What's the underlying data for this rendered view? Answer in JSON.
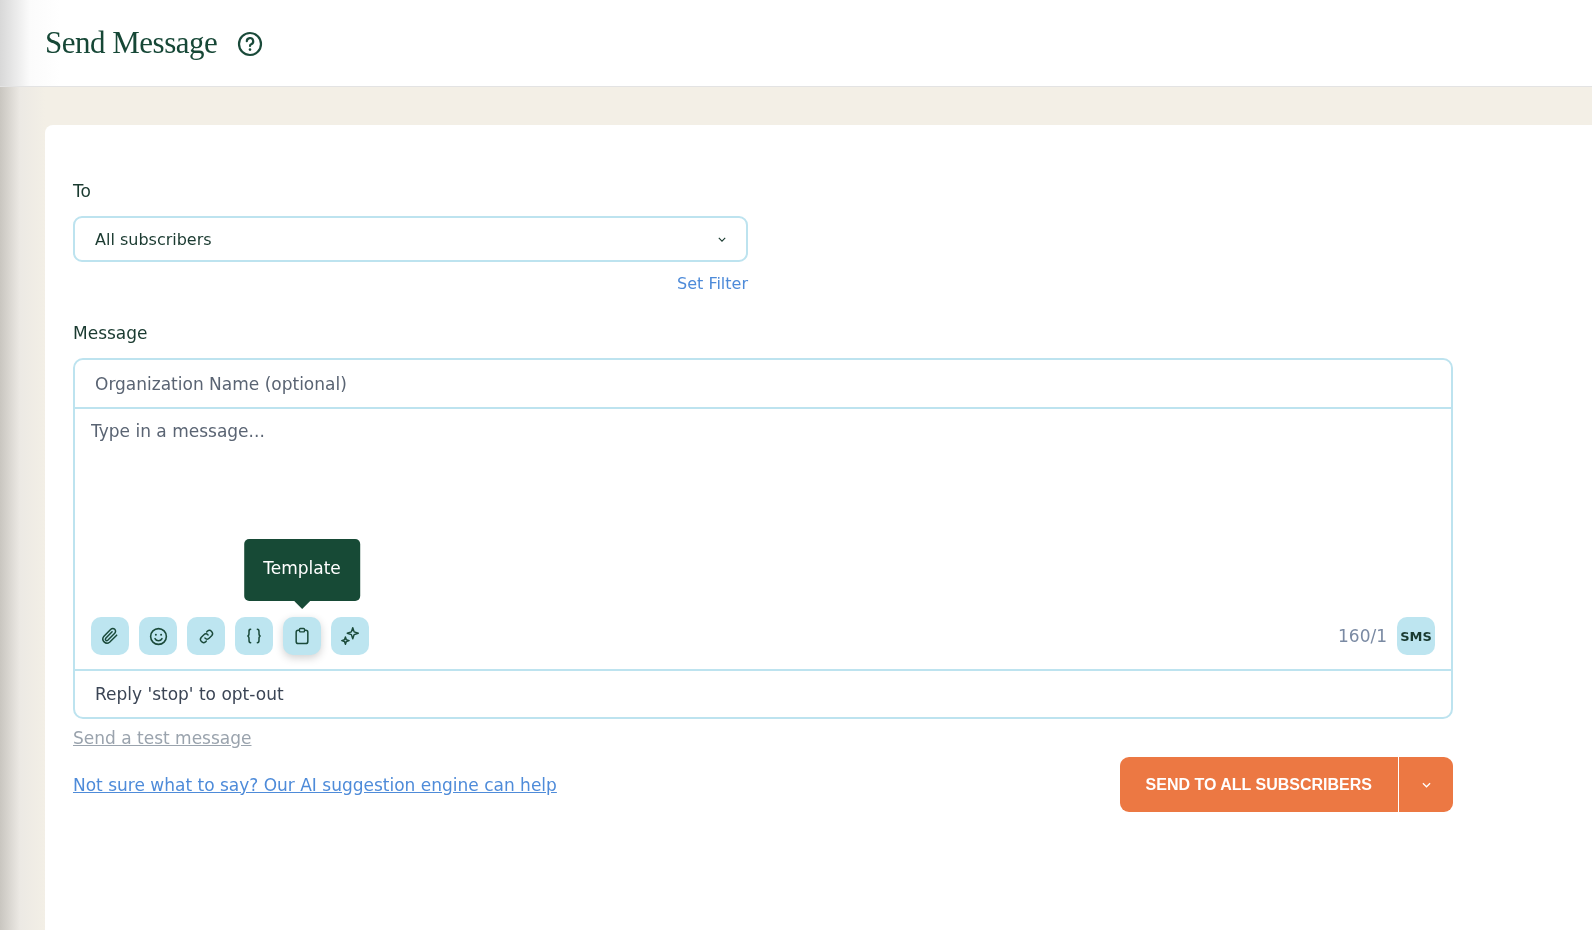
{
  "header": {
    "title": "Send Message"
  },
  "to": {
    "label": "To",
    "value": "All subscribers",
    "filter_link": "Set Filter"
  },
  "message": {
    "label": "Message",
    "org_placeholder": "Organization Name (optional)",
    "body_placeholder": "Type in a message...",
    "tools": [
      {
        "kind": "attach",
        "highlighted": false
      },
      {
        "kind": "emoji",
        "highlighted": false
      },
      {
        "kind": "link",
        "highlighted": false
      },
      {
        "kind": "braces",
        "highlighted": false
      },
      {
        "kind": "template",
        "highlighted": true,
        "tooltip": "Template"
      },
      {
        "kind": "sparkle",
        "highlighted": false
      }
    ],
    "counter": "160/1",
    "type_badge": "SMS",
    "footer": "Reply 'stop' to opt-out"
  },
  "test_link": "Send a test message",
  "ai_link": "Not sure what to say? Our AI suggestion engine can help",
  "send_button": "SEND TO ALL SUBSCRIBERS"
}
